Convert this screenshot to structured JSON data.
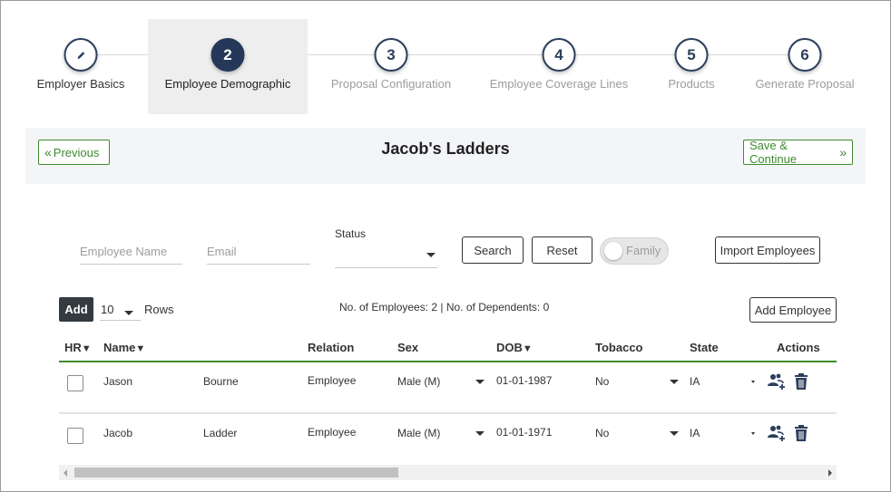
{
  "stepper": {
    "steps": [
      {
        "number": "",
        "icon": "pencil-icon",
        "label": "Employer Basics",
        "state": "done"
      },
      {
        "number": "2",
        "label": "Employee Demographic",
        "state": "active"
      },
      {
        "number": "3",
        "label": "Proposal Configuration",
        "state": "pending"
      },
      {
        "number": "4",
        "label": "Employee Coverage Lines",
        "state": "pending"
      },
      {
        "number": "5",
        "label": "Products",
        "state": "pending"
      },
      {
        "number": "6",
        "label": "Generate Proposal",
        "state": "pending"
      }
    ]
  },
  "header": {
    "previous_label": "Previous",
    "title": "Jacob's Ladders",
    "save_continue_label": "Save & Continue"
  },
  "filters": {
    "employee_name_placeholder": "Employee Name",
    "email_placeholder": "Email",
    "status_label": "Status",
    "status_value": "",
    "search_label": "Search",
    "reset_label": "Reset",
    "family_toggle_label": "Family",
    "family_toggle_on": false,
    "import_label": "Import Employees"
  },
  "table_controls": {
    "add_label": "Add",
    "rows_value": "10",
    "rows_label": "Rows",
    "counts_text": "No. of Employees: 2 | No. of Dependents: 0",
    "add_employee_label": "Add Employee"
  },
  "table": {
    "headers": {
      "hr": "HR",
      "name": "Name",
      "relation": "Relation",
      "sex": "Sex",
      "dob": "DOB",
      "tobacco": "Tobacco",
      "state": "State",
      "actions": "Actions"
    },
    "rows": [
      {
        "first": "Jason",
        "last": "Bourne",
        "relation": "Employee",
        "sex": "Male (M)",
        "dob": "01-01-1987",
        "tobacco": "No",
        "state": "IA"
      },
      {
        "first": "Jacob",
        "last": "Ladder",
        "relation": "Employee",
        "sex": "Male (M)",
        "dob": "01-01-1971",
        "tobacco": "No",
        "state": "IA"
      }
    ]
  },
  "colors": {
    "accent_green": "#3d8b2e",
    "step_navy": "#26385a"
  }
}
